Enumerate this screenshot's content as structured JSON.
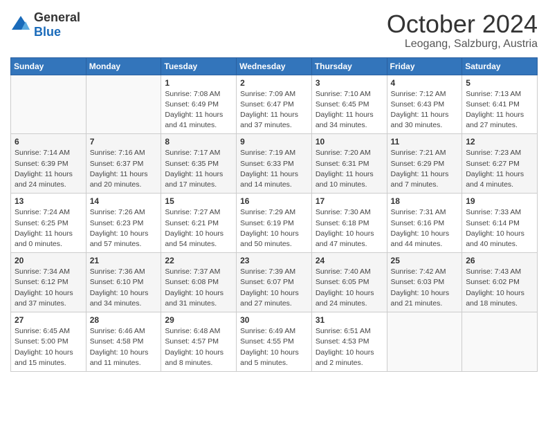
{
  "header": {
    "logo": {
      "general": "General",
      "blue": "Blue"
    },
    "title": "October 2024",
    "location": "Leogang, Salzburg, Austria"
  },
  "calendar": {
    "days_of_week": [
      "Sunday",
      "Monday",
      "Tuesday",
      "Wednesday",
      "Thursday",
      "Friday",
      "Saturday"
    ],
    "weeks": [
      [
        {
          "day": "",
          "info": ""
        },
        {
          "day": "",
          "info": ""
        },
        {
          "day": "1",
          "info": "Sunrise: 7:08 AM\nSunset: 6:49 PM\nDaylight: 11 hours and 41 minutes."
        },
        {
          "day": "2",
          "info": "Sunrise: 7:09 AM\nSunset: 6:47 PM\nDaylight: 11 hours and 37 minutes."
        },
        {
          "day": "3",
          "info": "Sunrise: 7:10 AM\nSunset: 6:45 PM\nDaylight: 11 hours and 34 minutes."
        },
        {
          "day": "4",
          "info": "Sunrise: 7:12 AM\nSunset: 6:43 PM\nDaylight: 11 hours and 30 minutes."
        },
        {
          "day": "5",
          "info": "Sunrise: 7:13 AM\nSunset: 6:41 PM\nDaylight: 11 hours and 27 minutes."
        }
      ],
      [
        {
          "day": "6",
          "info": "Sunrise: 7:14 AM\nSunset: 6:39 PM\nDaylight: 11 hours and 24 minutes."
        },
        {
          "day": "7",
          "info": "Sunrise: 7:16 AM\nSunset: 6:37 PM\nDaylight: 11 hours and 20 minutes."
        },
        {
          "day": "8",
          "info": "Sunrise: 7:17 AM\nSunset: 6:35 PM\nDaylight: 11 hours and 17 minutes."
        },
        {
          "day": "9",
          "info": "Sunrise: 7:19 AM\nSunset: 6:33 PM\nDaylight: 11 hours and 14 minutes."
        },
        {
          "day": "10",
          "info": "Sunrise: 7:20 AM\nSunset: 6:31 PM\nDaylight: 11 hours and 10 minutes."
        },
        {
          "day": "11",
          "info": "Sunrise: 7:21 AM\nSunset: 6:29 PM\nDaylight: 11 hours and 7 minutes."
        },
        {
          "day": "12",
          "info": "Sunrise: 7:23 AM\nSunset: 6:27 PM\nDaylight: 11 hours and 4 minutes."
        }
      ],
      [
        {
          "day": "13",
          "info": "Sunrise: 7:24 AM\nSunset: 6:25 PM\nDaylight: 11 hours and 0 minutes."
        },
        {
          "day": "14",
          "info": "Sunrise: 7:26 AM\nSunset: 6:23 PM\nDaylight: 10 hours and 57 minutes."
        },
        {
          "day": "15",
          "info": "Sunrise: 7:27 AM\nSunset: 6:21 PM\nDaylight: 10 hours and 54 minutes."
        },
        {
          "day": "16",
          "info": "Sunrise: 7:29 AM\nSunset: 6:19 PM\nDaylight: 10 hours and 50 minutes."
        },
        {
          "day": "17",
          "info": "Sunrise: 7:30 AM\nSunset: 6:18 PM\nDaylight: 10 hours and 47 minutes."
        },
        {
          "day": "18",
          "info": "Sunrise: 7:31 AM\nSunset: 6:16 PM\nDaylight: 10 hours and 44 minutes."
        },
        {
          "day": "19",
          "info": "Sunrise: 7:33 AM\nSunset: 6:14 PM\nDaylight: 10 hours and 40 minutes."
        }
      ],
      [
        {
          "day": "20",
          "info": "Sunrise: 7:34 AM\nSunset: 6:12 PM\nDaylight: 10 hours and 37 minutes."
        },
        {
          "day": "21",
          "info": "Sunrise: 7:36 AM\nSunset: 6:10 PM\nDaylight: 10 hours and 34 minutes."
        },
        {
          "day": "22",
          "info": "Sunrise: 7:37 AM\nSunset: 6:08 PM\nDaylight: 10 hours and 31 minutes."
        },
        {
          "day": "23",
          "info": "Sunrise: 7:39 AM\nSunset: 6:07 PM\nDaylight: 10 hours and 27 minutes."
        },
        {
          "day": "24",
          "info": "Sunrise: 7:40 AM\nSunset: 6:05 PM\nDaylight: 10 hours and 24 minutes."
        },
        {
          "day": "25",
          "info": "Sunrise: 7:42 AM\nSunset: 6:03 PM\nDaylight: 10 hours and 21 minutes."
        },
        {
          "day": "26",
          "info": "Sunrise: 7:43 AM\nSunset: 6:02 PM\nDaylight: 10 hours and 18 minutes."
        }
      ],
      [
        {
          "day": "27",
          "info": "Sunrise: 6:45 AM\nSunset: 5:00 PM\nDaylight: 10 hours and 15 minutes."
        },
        {
          "day": "28",
          "info": "Sunrise: 6:46 AM\nSunset: 4:58 PM\nDaylight: 10 hours and 11 minutes."
        },
        {
          "day": "29",
          "info": "Sunrise: 6:48 AM\nSunset: 4:57 PM\nDaylight: 10 hours and 8 minutes."
        },
        {
          "day": "30",
          "info": "Sunrise: 6:49 AM\nSunset: 4:55 PM\nDaylight: 10 hours and 5 minutes."
        },
        {
          "day": "31",
          "info": "Sunrise: 6:51 AM\nSunset: 4:53 PM\nDaylight: 10 hours and 2 minutes."
        },
        {
          "day": "",
          "info": ""
        },
        {
          "day": "",
          "info": ""
        }
      ]
    ]
  }
}
